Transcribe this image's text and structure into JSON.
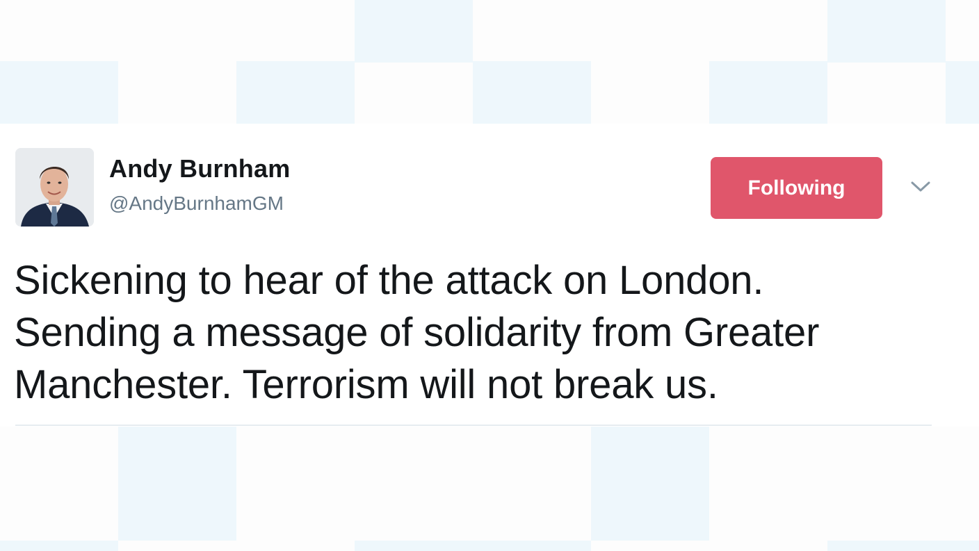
{
  "tweet": {
    "author_name": "Andy Burnham",
    "author_handle": "@AndyBurnhamGM",
    "follow_button_label": "Following",
    "text": "Sickening to hear of the attack on London.\nSending a message of solidarity from Greater\nManchester. Terrorism will not break us."
  },
  "icons": {
    "menu": "chevron-down-icon",
    "avatar": "profile-photo"
  },
  "colors": {
    "follow_button": "#e0566b",
    "handle_text": "#657786",
    "primary_text": "#14171a",
    "background_tile": "#eef7fc"
  }
}
